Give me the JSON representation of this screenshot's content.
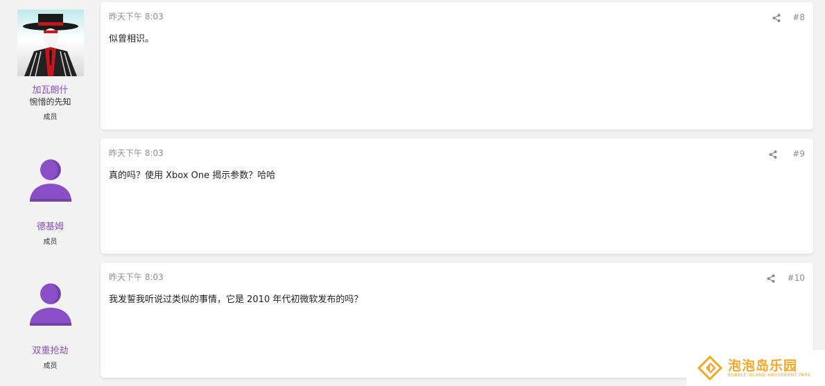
{
  "posts": [
    {
      "user": {
        "name": "加瓦朗什",
        "title": "惋惜的先知",
        "role": "成员",
        "avatar": "photo-avatar"
      },
      "time": "昨天下午 8:03",
      "number": "#8",
      "content": "似曾相识。",
      "share_icon": "share-icon"
    },
    {
      "user": {
        "name": "德基姆",
        "title": "",
        "role": "成员",
        "avatar": "default-avatar-icon"
      },
      "time": "昨天下午 8:03",
      "number": "#9",
      "content": "真的吗？使用 Xbox One 揭示参数？哈哈",
      "share_icon": "share-icon"
    },
    {
      "user": {
        "name": "双重抢劫",
        "title": "",
        "role": "成员",
        "avatar": "default-avatar-icon"
      },
      "time": "昨天下午 8:03",
      "number": "#10",
      "content": "我发誓我听说过类似的事情，它是 2010 年代初微软发布的吗？",
      "share_icon": "share-icon"
    }
  ],
  "watermark": {
    "title": "泡泡岛乐园",
    "subtitle": "BUBBLE ISLAND AMUSEMENT PARK",
    "color": "#f5a623"
  },
  "colors": {
    "username": "#8a4fc7",
    "avatar": "#8a4fc7",
    "meta": "#8c8c8c"
  }
}
